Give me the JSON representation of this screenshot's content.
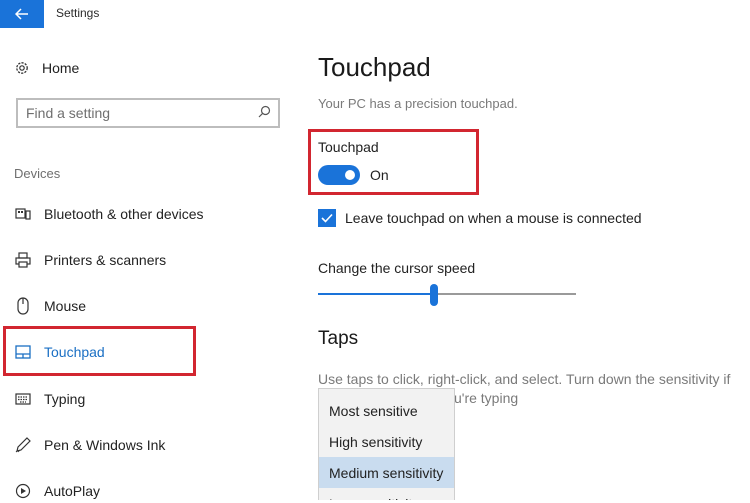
{
  "window": {
    "title": "Settings"
  },
  "sidebar": {
    "home_label": "Home",
    "search_placeholder": "Find a setting",
    "section_label": "Devices",
    "items": [
      {
        "label": "Bluetooth & other devices",
        "icon": "bluetooth-devices-icon"
      },
      {
        "label": "Printers & scanners",
        "icon": "printer-icon"
      },
      {
        "label": "Mouse",
        "icon": "mouse-icon"
      },
      {
        "label": "Touchpad",
        "icon": "touchpad-icon",
        "selected": true
      },
      {
        "label": "Typing",
        "icon": "keyboard-icon"
      },
      {
        "label": "Pen & Windows Ink",
        "icon": "pen-icon"
      },
      {
        "label": "AutoPlay",
        "icon": "autoplay-icon"
      }
    ]
  },
  "main": {
    "title": "Touchpad",
    "subtitle": "Your PC has a precision touchpad.",
    "toggle": {
      "label": "Touchpad",
      "state_text": "On",
      "on": true
    },
    "checkbox": {
      "label": "Leave touchpad on when a mouse is connected",
      "checked": true
    },
    "cursor_speed": {
      "label": "Change the cursor speed",
      "value_fraction": 0.45
    },
    "taps": {
      "heading": "Taps",
      "description_line1": "Use taps to click, right-click, and select. Turn down the sensitivity if",
      "description_line2": "u're typing",
      "sensitivity_options": [
        "Most sensitive",
        "High sensitivity",
        "Medium sensitivity",
        "Low sensitivity"
      ],
      "selected_option": "Medium sensitivity"
    }
  },
  "colors": {
    "accent": "#1a73d9",
    "highlight": "#d22630",
    "selected_text": "#1a6fc4"
  }
}
